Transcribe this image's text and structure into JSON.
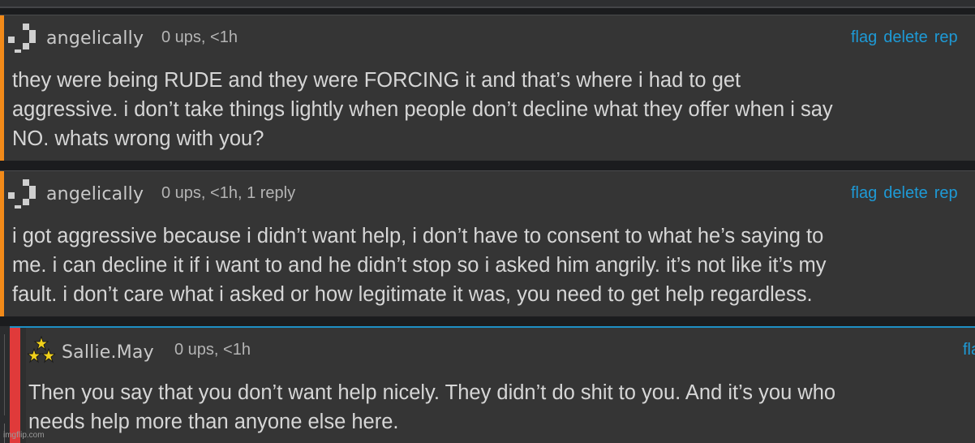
{
  "comments": [
    {
      "username": "angelically",
      "meta": "0 ups, <1h",
      "actions": [
        "flag",
        "delete",
        "rep"
      ],
      "lines": [
        "they were being RUDE and they were FORCING it and that’s where i had to get",
        "aggressive. i don’t take things lightly when people don’t decline what they offer when i say",
        "NO. whats wrong with you?"
      ]
    },
    {
      "username": "angelically",
      "meta": "0 ups, <1h, 1 reply",
      "actions": [
        "flag",
        "delete",
        "rep"
      ],
      "lines": [
        "i got aggressive because i didn’t want help, i don’t have to consent to what he’s saying to",
        "me. i can decline it if i want to and he didn’t stop so i asked him angrily. it’s not like it’s my",
        "fault. i don’t care what i asked or how legitimate it was, you need to get help regardless."
      ]
    }
  ],
  "reply": {
    "username": "Sallie.May",
    "meta": "0 ups, <1h",
    "action": "fla",
    "lines": [
      "Then you say that you don’t want help nicely. They didn’t do shit to you. And it’s you who",
      "needs help more than anyone else here."
    ]
  },
  "watermark": "imgflip.com",
  "colors": {
    "accent": "#f28a19",
    "link": "#1e9ad6",
    "reply_border": "#e03a3a",
    "reply_top": "#1e8fc4"
  },
  "icons": {
    "avatar_default": "pixel-avatar-icon",
    "avatar_reply": "stars-avatar-icon"
  }
}
